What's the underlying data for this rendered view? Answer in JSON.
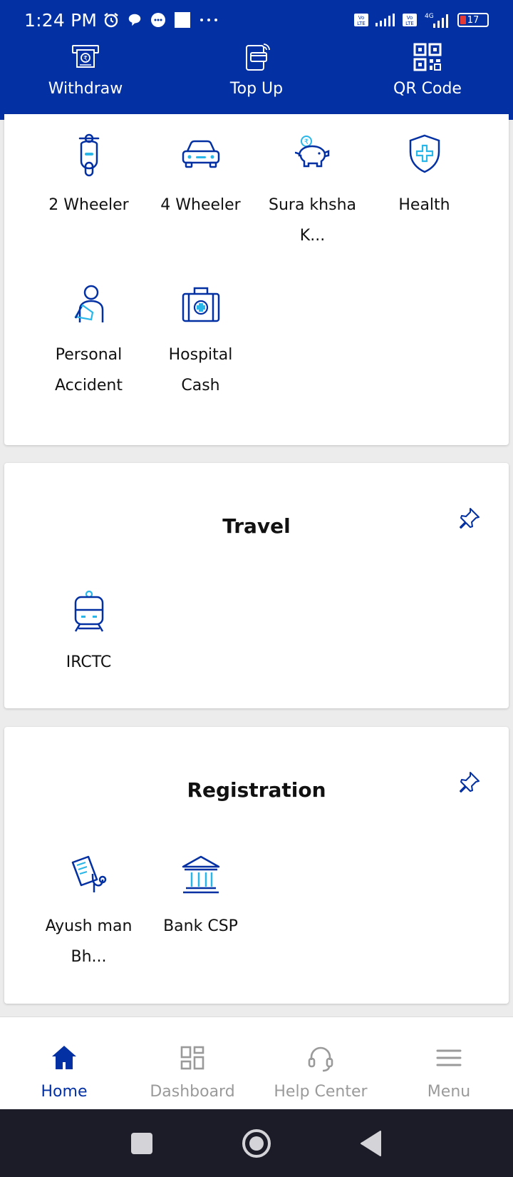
{
  "status_bar": {
    "time": "1:24 PM",
    "battery": "17",
    "network": "4G"
  },
  "quick_actions": [
    {
      "label": "Withdraw",
      "icon": "atm-withdraw-icon"
    },
    {
      "label": "Top Up",
      "icon": "mobile-topup-icon"
    },
    {
      "label": "QR Code",
      "icon": "qr-code-icon"
    }
  ],
  "insurance": {
    "items": [
      {
        "label": "2 Wheeler",
        "icon": "scooter-icon"
      },
      {
        "label": "4 Wheeler",
        "icon": "car-icon"
      },
      {
        "label": "Sura khsha K...",
        "icon": "piggy-bank-icon"
      },
      {
        "label": "Health",
        "icon": "health-shield-icon"
      },
      {
        "label": "Personal Accident",
        "icon": "injured-person-icon"
      },
      {
        "label": "Hospital Cash",
        "icon": "medical-kit-icon"
      }
    ]
  },
  "travel": {
    "title": "Travel",
    "items": [
      {
        "label": "IRCTC",
        "icon": "train-icon"
      }
    ]
  },
  "registration": {
    "title": "Registration",
    "items": [
      {
        "label": "Ayush man Bh...",
        "icon": "medical-report-icon"
      },
      {
        "label": "Bank CSP",
        "icon": "bank-icon"
      }
    ]
  },
  "bottom_nav": [
    {
      "label": "Home",
      "icon": "home-icon",
      "active": true
    },
    {
      "label": "Dashboard",
      "icon": "dashboard-icon",
      "active": false
    },
    {
      "label": "Help Center",
      "icon": "headset-icon",
      "active": false
    },
    {
      "label": "Menu",
      "icon": "hamburger-menu-icon",
      "active": false
    }
  ],
  "colors": {
    "primary": "#0330a3",
    "accent": "#29b6e8",
    "inactive": "#9a9a9a"
  }
}
